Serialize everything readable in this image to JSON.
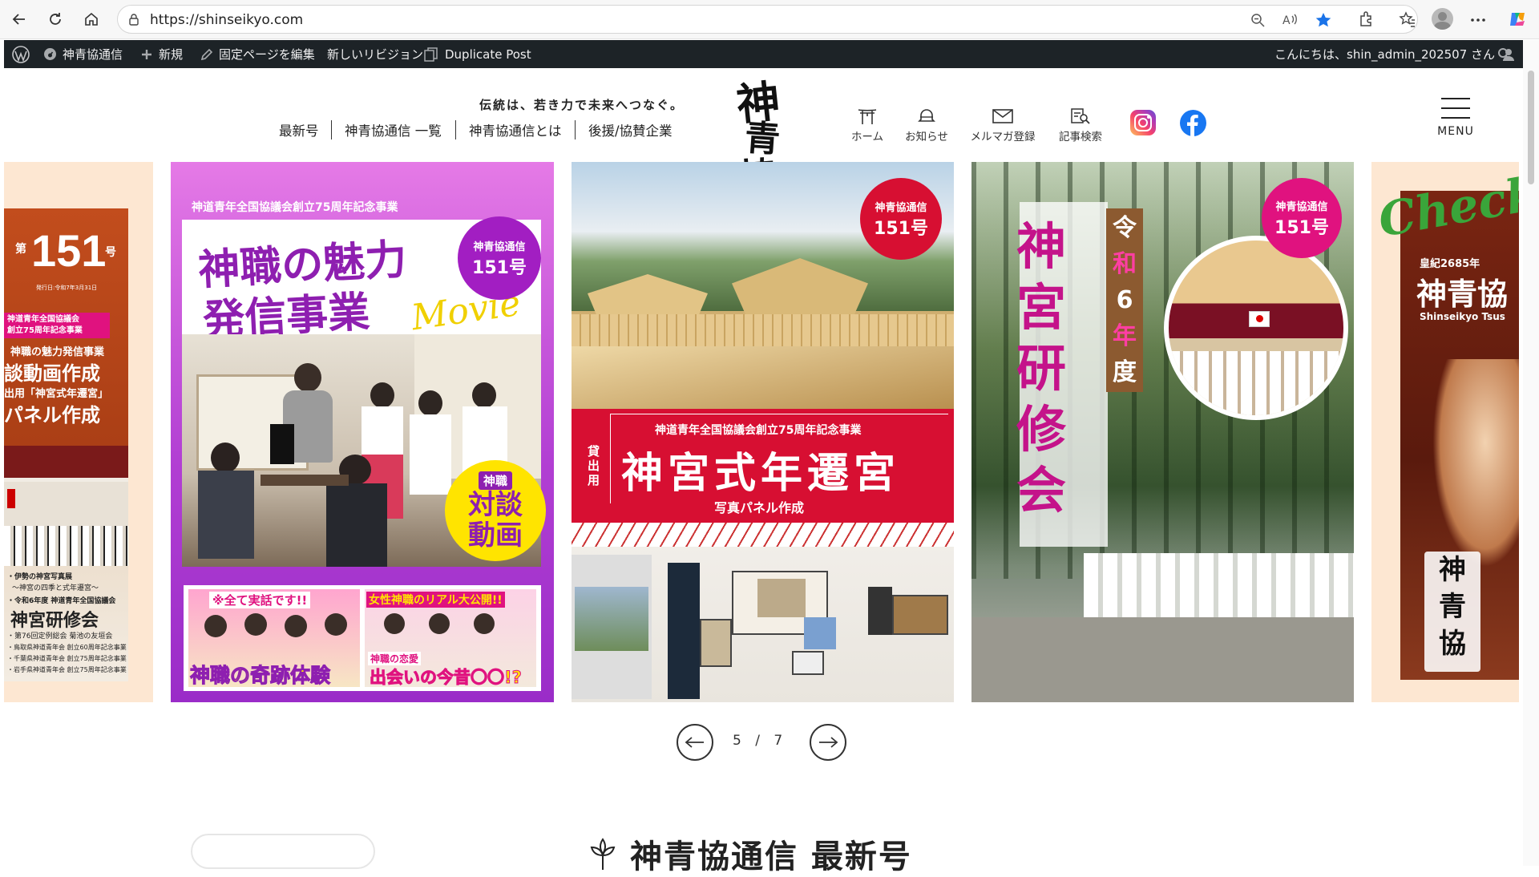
{
  "browser": {
    "url": "https://shinseikyo.com"
  },
  "admin_bar": {
    "site_name": "神青協通信",
    "new_label": "新規",
    "edit_label": "固定ページを編集",
    "revision_label": "新しいリビジョン",
    "duplicate_label": "Duplicate Post",
    "greeting": "こんにちは、shin_admin_202507 さん"
  },
  "header": {
    "tagline": "伝統は、若き力で未来へつなぐ。",
    "nav": [
      "最新号",
      "神青協通信 一覧",
      "神青協通信とは",
      "後援/協賛企業"
    ],
    "logo_text": [
      "神",
      "青",
      "協"
    ],
    "icons": [
      {
        "label": "ホーム",
        "icon": "torii-icon"
      },
      {
        "label": "お知らせ",
        "icon": "bell-icon"
      },
      {
        "label": "メルマガ登録",
        "icon": "mail-icon"
      },
      {
        "label": "記事検索",
        "icon": "search-doc-icon"
      }
    ],
    "social": [
      "instagram-icon",
      "facebook-icon"
    ],
    "menu_label": "MENU"
  },
  "slides": {
    "left_partial": {
      "issue_prefix": "第",
      "issue_number": "151",
      "issue_suffix": "号",
      "date_line": "発行日:令和7年3月31日",
      "banner": "神道青年全国協議会\n創立75周年記念事業",
      "line1": "神職の魅力発信事業",
      "line2": "談動画作成",
      "line3": "出用「神宮式年遷宮」",
      "line4": "パネル作成",
      "lower1": "・伊勢の神宮写真展",
      "lower2": "〜神宮の四季と式年遷宮〜",
      "lower3": "・令和6年度 神道青年全国協議会",
      "lower4": "神宮研修会",
      "lower5": "・第76回定例総会 菊池の友垣会",
      "lower6": "・鳥取県神道青年会 創立60周年記念事業",
      "lower7": "・千葉県神道青年会 創立75周年記念事業",
      "lower8": "・岩手県神道青年会 創立75周年記念事業"
    },
    "slide1": {
      "header": "神道青年全国協議会創立75周年記念事業",
      "title1": "神職の魅力",
      "title2": "発信事業",
      "script": "Movie",
      "badge_line1": "神青協通信",
      "badge_line2": "151号",
      "yellow_line1": "神職",
      "yellow_line2": "対談",
      "yellow_line3": "動画",
      "thumb1_top": "※全て実話です!!",
      "thumb1_bottom": "神職の奇跡体験",
      "thumb2_top": "女性神職のリアル大公開!!",
      "thumb2_mid": "神職の恋愛",
      "thumb2_bottom": "出会いの今昔〇〇!?"
    },
    "slide2": {
      "badge_line1": "神青協通信",
      "badge_line2": "151号",
      "header": "神道青年全国協議会創立75周年記念事業",
      "side": "貸出用",
      "title": "神宮式年遷宮",
      "subtitle": "写真パネル作成"
    },
    "slide3": {
      "badge_line1": "神青協通信",
      "badge_line2": "151号",
      "vertical_small": [
        "令",
        "和",
        "6",
        "年",
        "度"
      ],
      "vertical_big": [
        "神",
        "宮",
        "研",
        "修",
        "会"
      ]
    },
    "right_partial": {
      "script": "Check",
      "line1": "皇紀2685年",
      "line2": "神青協",
      "line3": "Shinseikyo Tsus",
      "logo": [
        "神",
        "青",
        "協"
      ]
    }
  },
  "pagination": {
    "current": "5",
    "separator": "/",
    "total": "7"
  },
  "section": {
    "title": "神青協通信 最新号"
  },
  "colors": {
    "wpbar": "#1d2327",
    "magenta": "#e0127f",
    "crimson": "#d70f32",
    "purple": "#8e1fb0",
    "yellow": "#ffe400"
  }
}
